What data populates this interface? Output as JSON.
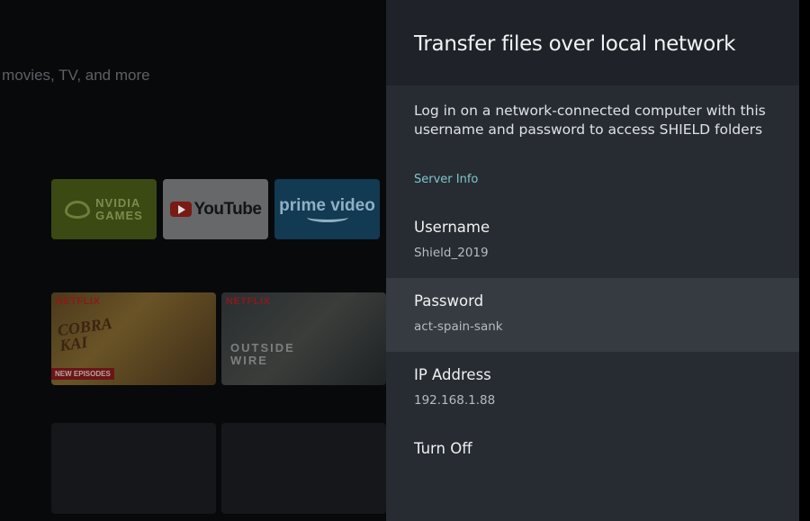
{
  "background": {
    "tagline": "n movies, TV, and more",
    "apps": [
      {
        "name": "NVIDIA GAMES",
        "line1": "NVIDIA",
        "line2": "GAMES"
      },
      {
        "name": "YouTube"
      },
      {
        "name": "prime video"
      }
    ],
    "shows": [
      {
        "badge": "NETFLIX",
        "title": "COBRA KAI",
        "line1": "COBRA",
        "line2": "KAI",
        "tag": "NEW EPISODES"
      },
      {
        "badge": "NETFLIX",
        "title": "OUTSIDE WIRE",
        "line1": "OUTSIDE",
        "line2": "WIRE"
      }
    ]
  },
  "panel": {
    "title": "Transfer files over local network",
    "description": "Log in on a network-connected computer with this username and password to access SHIELD folders",
    "section_label": "Server Info",
    "rows": {
      "username": {
        "title": "Username",
        "value": "Shield_2019"
      },
      "password": {
        "title": "Password",
        "value": "act-spain-sank"
      },
      "ip": {
        "title": "IP Address",
        "value": "192.168.1.88"
      },
      "turn_off": {
        "title": "Turn Off"
      }
    }
  },
  "colors": {
    "panel_bg": "#272c32",
    "header_bg": "#1f2329",
    "selected_row": "#353b41",
    "accent": "#7fc6cf"
  }
}
